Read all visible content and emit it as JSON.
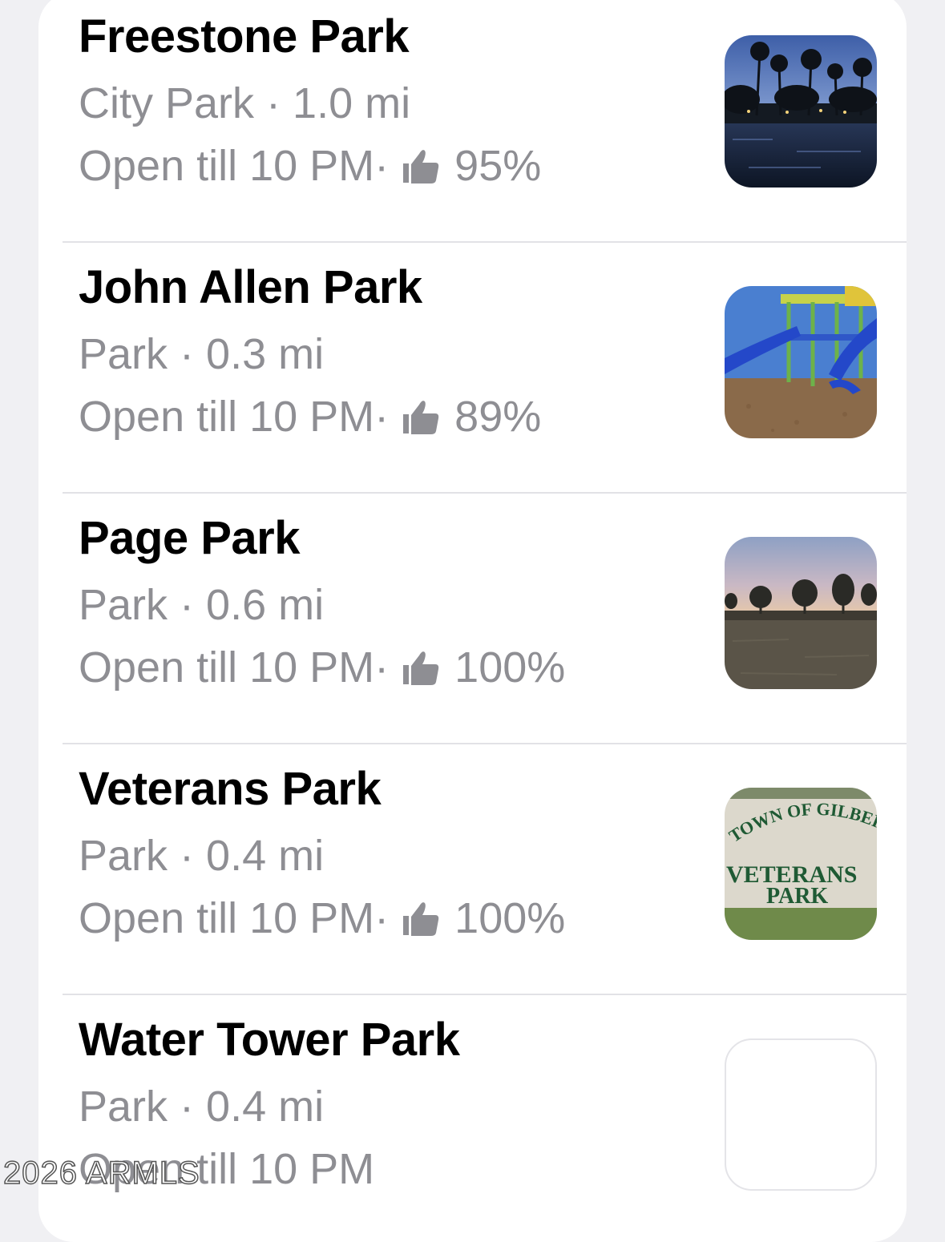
{
  "places": [
    {
      "name": "Freestone Park",
      "category": "City Park",
      "distance": "1.0 mi",
      "hours": "Open till 10 PM",
      "rating": "95%",
      "thumbnail": "lake-palms-photo"
    },
    {
      "name": "John Allen Park",
      "category": "Park",
      "distance": "0.3 mi",
      "hours": "Open till 10 PM",
      "rating": "89%",
      "thumbnail": "playground-photo"
    },
    {
      "name": "Page Park",
      "category": "Park",
      "distance": "0.6 mi",
      "hours": "Open till 10 PM",
      "rating": "100%",
      "thumbnail": "field-sunset-photo"
    },
    {
      "name": "Veterans Park",
      "category": "Park",
      "distance": "0.4 mi",
      "hours": "Open till 10 PM",
      "rating": "100%",
      "thumbnail": "sign-photo",
      "sign_text": {
        "arc": "TOWN OF GILBERT",
        "line1": "VETERANS",
        "line2": "PARK"
      }
    },
    {
      "name": "Water Tower Park",
      "category": "Park",
      "distance": "0.4 mi",
      "hours": "Open till 10 PM",
      "rating": null,
      "thumbnail": "empty"
    }
  ],
  "separator": " · ",
  "watermark": "2026 ARMLS",
  "colors": {
    "secondary_text": "#8e8e93",
    "primary_text": "#000000"
  },
  "icons": {
    "rating": "thumbs-up-icon"
  }
}
